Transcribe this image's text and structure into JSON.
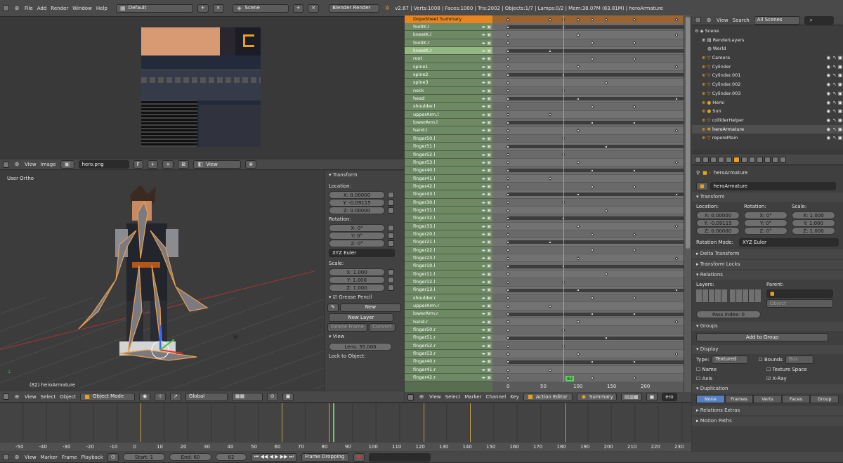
{
  "topbar": {
    "menus": [
      "File",
      "Add",
      "Render",
      "Window",
      "Help"
    ],
    "layout": "Default",
    "scene": "Scene",
    "engine": "Blender Render",
    "stats": "v2.67 | Verts:1008 | Faces:1000 | Tris:2002 | Objects:1/7 | Lamps:0/2 | Mem:38.07M (83.81M) | heroArmature"
  },
  "image_editor": {
    "menus": [
      "View",
      "Image"
    ],
    "image_name": "hero.png",
    "f_label": "F",
    "view_mode": "View"
  },
  "viewport": {
    "label": "User Ortho",
    "object_label": "(82) heroArmature",
    "menus": [
      "View",
      "Select",
      "Object"
    ],
    "mode": "Object Mode",
    "orientation": "Global"
  },
  "npanel": {
    "transform_title": "Transform",
    "location_label": "Location:",
    "loc": [
      "X: 0.00000",
      "Y: -0.09115",
      "Z: 0.00000"
    ],
    "rotation_label": "Rotation:",
    "rot": [
      "X: 0°",
      "Y: 0°",
      "Z: 0°"
    ],
    "rot_mode": "XYZ Euler",
    "scale_label": "Scale:",
    "scale": [
      "X: 1.000",
      "Y: 1.000",
      "Z: 1.000"
    ],
    "grease_title": "Grease Pencil",
    "new_label": "New",
    "new_layer": "New Layer",
    "delete_frame": "Delete Frame",
    "convert": "Convert",
    "view_title": "View",
    "lens": "Lens: 35.000",
    "lock_label": "Lock to Object:"
  },
  "dopesheet": {
    "summary": "DopeSheet Summary",
    "channels": [
      "footIK.l",
      "kneeIK.l",
      "footIK.r",
      "kneeIK.r",
      "root",
      "spine1",
      "spine2",
      "spine3",
      "neck",
      "head",
      "shoulder.l",
      "upperArm.l",
      "lowerArm.l",
      "hand.l",
      "finger50.l",
      "finger51.l",
      "finger52.l",
      "finger53.l",
      "finger40.l",
      "finger41.l",
      "finger42.l",
      "finger43.l",
      "finger30.l",
      "finger31.l",
      "finger32.l",
      "finger33.l",
      "finger20.l",
      "finger21.l",
      "finger22.l",
      "finger23.l",
      "finger10.l",
      "finger11.l",
      "finger12.l",
      "finger13.l",
      "shoulder.r",
      "upperArm.r",
      "lowerArm.r",
      "hand.r",
      "finger50.r",
      "finger51.r",
      "finger52.r",
      "finger53.r",
      "finger40.r",
      "finger41.r",
      "finger42.r"
    ],
    "ticks": [
      "0",
      "50",
      "100",
      "150",
      "200"
    ],
    "current_frame": "82",
    "menus": [
      "View",
      "Select",
      "Marker",
      "Channel",
      "Key"
    ],
    "mode": "Action Editor",
    "summary_btn": "Summary",
    "truncated": "ero"
  },
  "outliner": {
    "menus": [
      "View",
      "Search"
    ],
    "scope": "All Scenes",
    "items": [
      "Scene",
      "RenderLayers",
      "World",
      "Camera",
      "Cylinder",
      "Cylinder.001",
      "Cylinder.002",
      "Cylinder.003",
      "Hemi",
      "Sun",
      "colliderHelper",
      "heroArmature",
      "repereMain"
    ]
  },
  "properties": {
    "breadcrumb": "heroArmature",
    "object_name": "heroArmature",
    "transform_title": "Transform",
    "location_label": "Location:",
    "rotation_label": "Rotation:",
    "scale_label": "Scale:",
    "loc": [
      "X: 0.00000",
      "Y: -0.09115",
      "Z: 0.00000"
    ],
    "rot": [
      "X: 0°",
      "Y: 0°",
      "Z: 0°"
    ],
    "scale": [
      "X: 1.000",
      "Y: 1.000",
      "Z: 1.000"
    ],
    "rot_mode_label": "Rotation Mode:",
    "rot_mode": "XYZ Euler",
    "delta": "Delta Transform",
    "locks": "Transform Locks",
    "relations": "Relations",
    "layers_label": "Layers:",
    "parent_label": "Parent:",
    "parent_type": "Object",
    "pass_index": "Pass Index: 0",
    "groups": "Groups",
    "add_to_group": "Add to Group",
    "display": "Display",
    "type_label": "Type:",
    "type_value": "Textured",
    "bounds": "Bounds",
    "bounds_value": "Box",
    "name": "Name",
    "texture_space": "Texture Space",
    "axis": "Axis",
    "xray": "X-Ray",
    "duplication": "Duplication",
    "dup_tabs": [
      "None",
      "Frames",
      "Verts",
      "Faces",
      "Group"
    ],
    "relations_extras": "Relations Extras",
    "motion_paths": "Motion Paths"
  },
  "timeline": {
    "ticks": [
      "-50",
      "-40",
      "-30",
      "-20",
      "-10",
      "0",
      "10",
      "20",
      "30",
      "40",
      "50",
      "60",
      "70",
      "80",
      "90",
      "100",
      "110",
      "120",
      "130",
      "140",
      "150",
      "160",
      "170",
      "180",
      "190",
      "200",
      "210",
      "220",
      "230"
    ],
    "menus": [
      "View",
      "Marker",
      "Frame",
      "Playback"
    ],
    "start": "Start: 1",
    "end": "End: 60",
    "frame": "82",
    "sync": "Frame Dropping"
  },
  "colors": {
    "accent": "#e9851e",
    "selected": "#95b882",
    "channel": "#6d8a64",
    "playhead": "#5fd35f"
  }
}
